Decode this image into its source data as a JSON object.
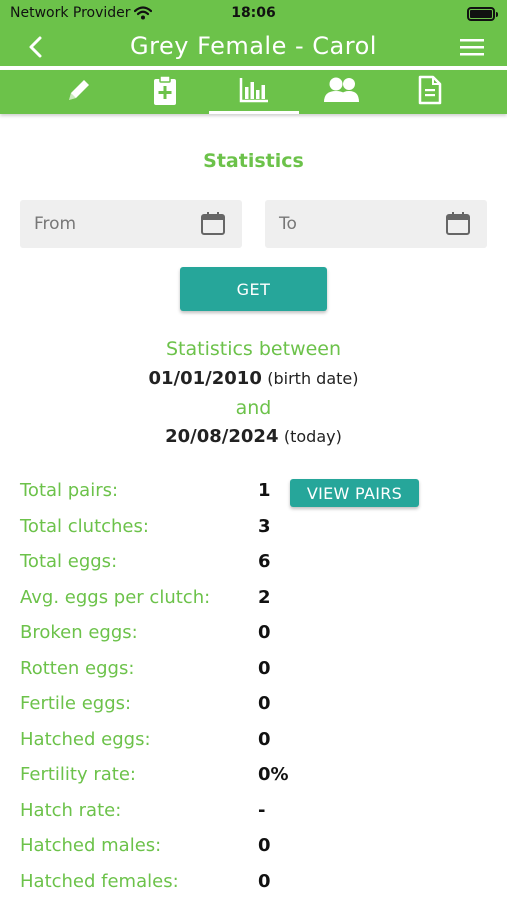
{
  "status": {
    "provider": "Network Provider",
    "time": "18:06"
  },
  "header": {
    "title": "Grey Female - Carol"
  },
  "tabs": [
    {
      "icon": "pencil-icon"
    },
    {
      "icon": "clipboard-plus-icon"
    },
    {
      "icon": "bar-chart-icon",
      "active": true
    },
    {
      "icon": "people-icon"
    },
    {
      "icon": "document-icon"
    }
  ],
  "statistics": {
    "title": "Statistics",
    "from_placeholder": "From",
    "to_placeholder": "To",
    "get_label": "GET",
    "between_label": "Statistics between",
    "start_date": "01/01/2010",
    "start_note": "(birth date)",
    "and_label": "and",
    "end_date": "20/08/2024",
    "end_note": "(today)",
    "view_pairs_label": "VIEW PAIRS",
    "rows": [
      {
        "label": "Total pairs:",
        "value": "1"
      },
      {
        "label": "Total clutches:",
        "value": "3"
      },
      {
        "label": "Total eggs:",
        "value": "6"
      },
      {
        "label": "Avg. eggs per clutch:",
        "value": "2"
      },
      {
        "label": "Broken eggs:",
        "value": "0"
      },
      {
        "label": "Rotten eggs:",
        "value": "0"
      },
      {
        "label": "Fertile eggs:",
        "value": "0"
      },
      {
        "label": "Hatched eggs:",
        "value": "0"
      },
      {
        "label": "Fertility rate:",
        "value": "0%"
      },
      {
        "label": "Hatch rate:",
        "value": "-"
      },
      {
        "label": "Hatched males:",
        "value": "0"
      },
      {
        "label": "Hatched females:",
        "value": "0"
      }
    ]
  },
  "colors": {
    "primary": "#6cc24a",
    "accent": "#26a69a",
    "field": "#efefef"
  }
}
